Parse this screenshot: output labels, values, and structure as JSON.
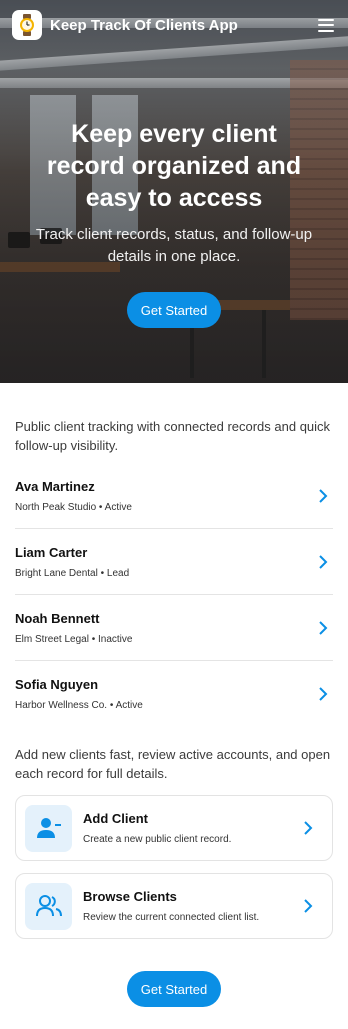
{
  "header": {
    "app_title": "Keep Track Of Clients App",
    "logo_icon": "watch-icon",
    "menu_icon": "hamburger-menu-icon"
  },
  "hero": {
    "title": "Keep every client record organized and easy to access",
    "subtitle": "Track client records, status, and follow-up details in one place.",
    "cta_label": "Get Started"
  },
  "main": {
    "intro": "Public client tracking with connected records and quick follow-up visibility.",
    "clients": [
      {
        "name": "Ava Martinez",
        "meta": "North Peak Studio • Active"
      },
      {
        "name": "Liam Carter",
        "meta": "Bright Lane Dental • Lead"
      },
      {
        "name": "Noah Bennett",
        "meta": "Elm Street Legal • Inactive"
      },
      {
        "name": "Sofia Nguyen",
        "meta": "Harbor Wellness Co. • Active"
      }
    ],
    "outro": "Add new clients fast, review active accounts, and open each record for full details.",
    "actions": [
      {
        "title": "Add Client",
        "desc": "Create a new public client record.",
        "icon": "add-user-icon"
      },
      {
        "title": "Browse Clients",
        "desc": "Review the current connected client list.",
        "icon": "users-icon"
      }
    ],
    "bottom_cta_label": "Get Started"
  },
  "colors": {
    "accent": "#0b8fe5",
    "icon_bg": "#e4f1fb"
  }
}
